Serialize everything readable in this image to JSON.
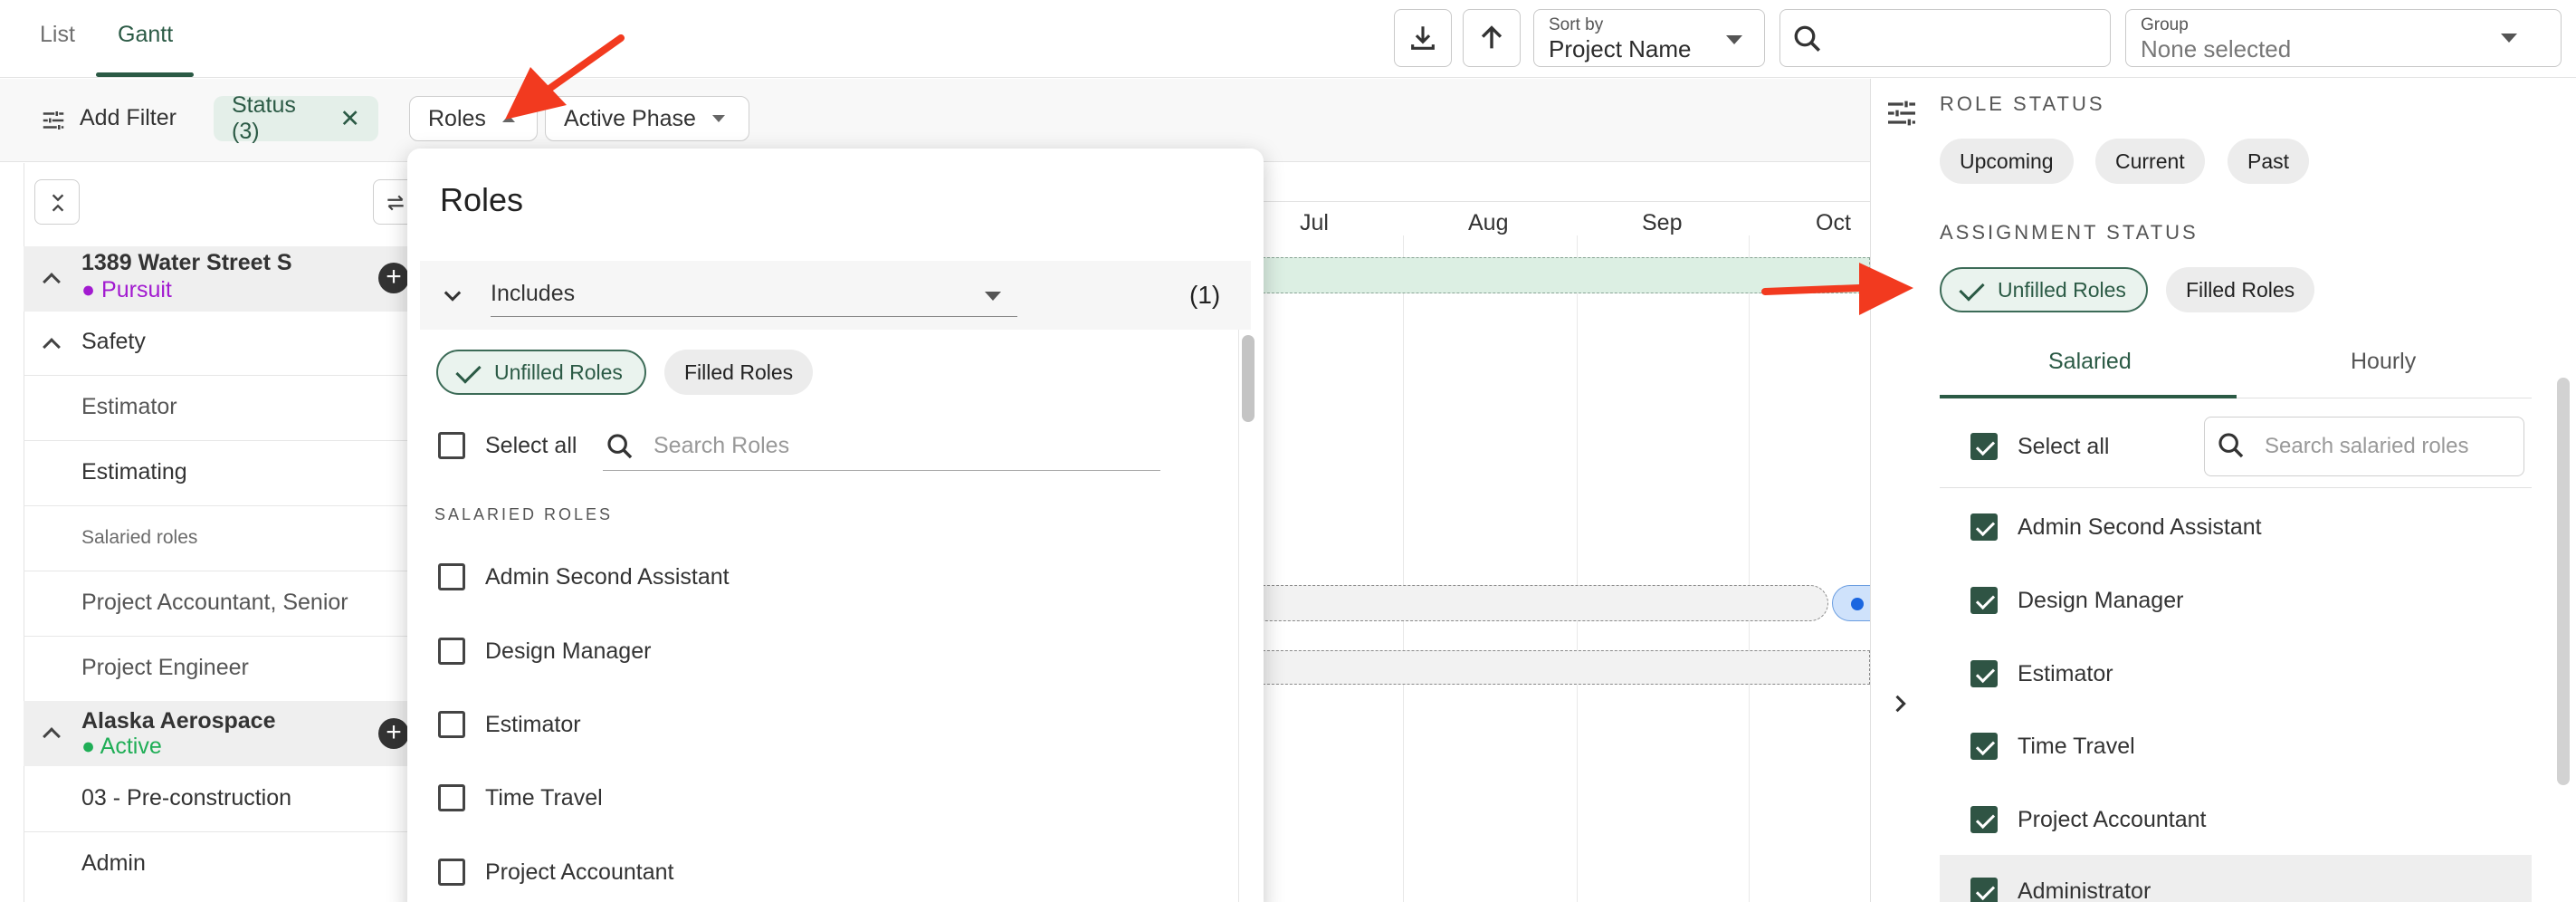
{
  "tabs": [
    "List",
    "Gantt"
  ],
  "active_tab": "Gantt",
  "toolbar": {
    "download_icon": "download-icon",
    "sort_direction_icon": "arrow-up-icon",
    "sort_label": "Sort by",
    "sort_value": "Project Name",
    "group_label": "Group",
    "group_value": "None selected",
    "search_placeholder": ""
  },
  "filter_bar": {
    "add_filter": "Add Filter",
    "chips": [
      "Status (3)",
      "Roles",
      "Active Phase"
    ]
  },
  "left_grid": {
    "rows": [
      {
        "type": "group",
        "title": "1389 Water Street S",
        "status": "● Pursuit",
        "status_color": "#a21ad0"
      },
      {
        "type": "section",
        "label": "Safety"
      },
      {
        "type": "item",
        "label": "Estimator"
      },
      {
        "type": "item",
        "label": "Estimating"
      },
      {
        "type": "small",
        "label": "Salaried roles"
      },
      {
        "type": "item",
        "label": "Project Accountant, Senior"
      },
      {
        "type": "item",
        "label": "Project Engineer"
      },
      {
        "type": "group",
        "title": "Alaska Aerospace",
        "status": "● Active",
        "status_color": "#1fae56"
      },
      {
        "type": "item",
        "label": "03 - Pre-construction"
      },
      {
        "type": "item",
        "label": "Admin"
      }
    ]
  },
  "gantt": {
    "months": [
      "Jul",
      "Aug",
      "Sep",
      "Oct"
    ]
  },
  "roles_dropdown": {
    "title": "Roles",
    "operator": "Includes",
    "count": "(1)",
    "pills": [
      {
        "label": "Unfilled Roles",
        "selected": true
      },
      {
        "label": "Filled Roles",
        "selected": false
      }
    ],
    "select_all": "Select all",
    "search_placeholder": "Search Roles",
    "section": "SALARIED ROLES",
    "roles": [
      "Admin Second Assistant",
      "Design Manager",
      "Estimator",
      "Time Travel",
      "Project Accountant"
    ]
  },
  "right_panel": {
    "role_status_label": "ROLE STATUS",
    "role_status": [
      "Upcoming",
      "Current",
      "Past"
    ],
    "assignment_status_label": "ASSIGNMENT STATUS",
    "assignment_status": [
      {
        "label": "Unfilled Roles",
        "selected": true
      },
      {
        "label": "Filled Roles",
        "selected": false
      }
    ],
    "tabs": [
      "Salaried",
      "Hourly"
    ],
    "select_all": "Select all",
    "search_placeholder": "Search salaried roles",
    "roles": [
      "Admin Second Assistant",
      "Design Manager",
      "Estimator",
      "Time Travel",
      "Project Accountant",
      "Administrator"
    ]
  },
  "colors": {
    "brand_green": "#2b5a45",
    "annotation_red": "#f23a1f"
  }
}
